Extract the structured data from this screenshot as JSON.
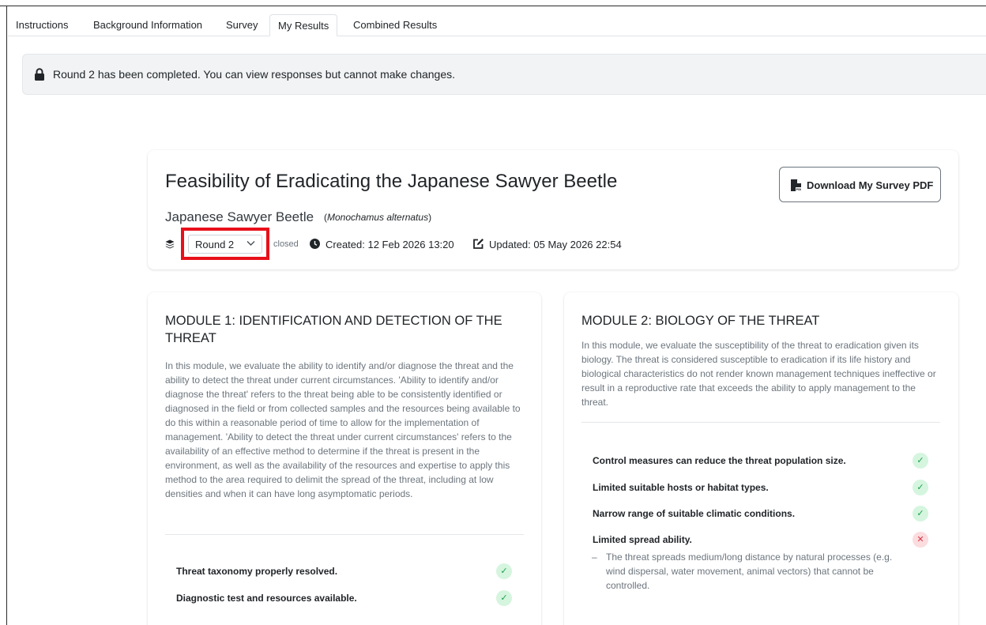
{
  "tabs": [
    {
      "label": "Instructions",
      "active": false
    },
    {
      "label": "Background Information",
      "active": false
    },
    {
      "label": "Survey",
      "active": false
    },
    {
      "label": "My Results",
      "active": true
    },
    {
      "label": "Combined Results",
      "active": false
    }
  ],
  "alert": {
    "icon": "lock-icon",
    "message": "Round 2 has been completed. You can view responses but cannot make changes."
  },
  "header": {
    "title": "Feasibility of Eradicating the Japanese Sawyer Beetle",
    "download_button": "Download My Survey PDF",
    "species_common": "Japanese Sawyer Beetle",
    "species_scientific": "Monochamus alternatus",
    "round_select": {
      "value": "Round 2"
    },
    "status": "closed",
    "created": "Created: 12 Feb 2026 13:20",
    "updated": "Updated: 05 May 2026 22:54",
    "highlight_color": "#e8101a"
  },
  "modules": [
    {
      "title": "MODULE 1: IDENTIFICATION AND DETECTION OF THE THREAT",
      "description": "In this module, we evaluate the ability to identify and/or diagnose the threat and the ability to detect the threat under current circumstances. 'Ability to identify and/or diagnose the threat' refers to the threat being able to be consistently identified or diagnosed in the field or from collected samples and the resources being available to do this within a reasonable period of time to allow for the implementation of management. 'Ability to detect the threat under current circumstances' refers to the availability of an effective method to determine if the threat is present in the environment, as well as the availability of the resources and expertise to apply this method to the area required to delimit the spread of the threat, including at low densities and when it can have long asymptomatic periods.",
      "criteria": [
        {
          "label": "Threat taxonomy properly resolved.",
          "result": "check-icon"
        },
        {
          "label": "Diagnostic test and resources available.",
          "result": "check-icon"
        }
      ]
    },
    {
      "title": "MODULE 2: BIOLOGY OF THE THREAT",
      "description": "In this module, we evaluate the susceptibility of the threat to eradication given its biology. The threat is considered susceptible to eradication if its life history and biological characteristics do not render known management techniques ineffective or result in a reproductive rate that exceeds the ability to apply management to the threat.",
      "criteria": [
        {
          "label": "Control measures can reduce the threat population size.",
          "result": "check-icon"
        },
        {
          "label": "Limited suitable hosts or habitat types.",
          "result": "check-icon"
        },
        {
          "label": "Narrow range of suitable climatic conditions.",
          "result": "check-icon"
        },
        {
          "label": "Limited spread ability.",
          "result": "cross-icon",
          "note": "The threat spreads medium/long distance by natural processes (e.g. wind dispersal, water movement, animal vectors) that cannot be controlled."
        }
      ]
    }
  ],
  "symbols": {
    "check": "✓",
    "cross": "✕",
    "dash": "–"
  },
  "colors": {
    "ok_bg": "#d5f5df",
    "ok_fg": "#1b9e4b",
    "no_bg": "#fbdcdf",
    "no_fg": "#d93445",
    "alert_bg": "#f1f3f4"
  }
}
